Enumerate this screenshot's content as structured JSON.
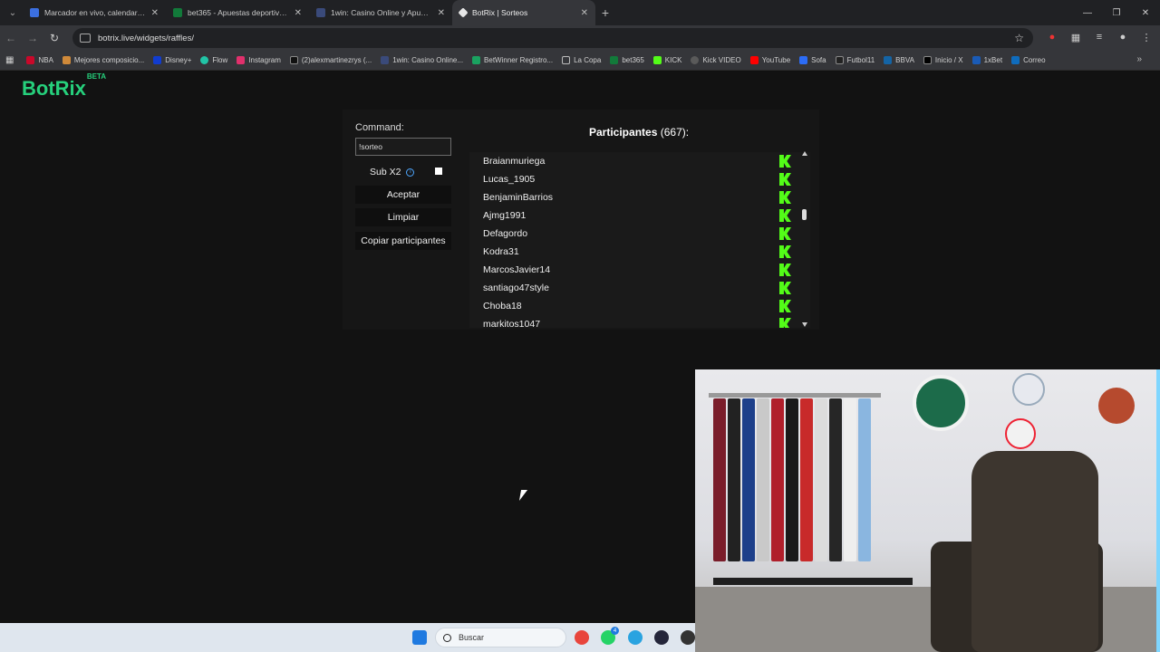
{
  "tabs": [
    {
      "title": "Marcador en vivo, calendario y",
      "color": "#3b6fe0",
      "active": false
    },
    {
      "title": "bet365 - Apuestas deportivas e",
      "color": "#127a3a",
      "active": false
    },
    {
      "title": "1win: Casino Online y Apuestas",
      "color": "#3a4a7a",
      "active": false
    },
    {
      "title": "BotRix | Sorteos",
      "color": "#e6e6e6",
      "active": true
    }
  ],
  "address": {
    "url": "botrix.live/widgets/raffles/"
  },
  "bookmarks": [
    {
      "label": "NBA",
      "color": "#c9082a"
    },
    {
      "label": "Mejores composicio...",
      "color": "#d08a3a"
    },
    {
      "label": "Disney+",
      "color": "#113ccf"
    },
    {
      "label": "Flow",
      "color": "#21c4a6"
    },
    {
      "label": "Instagram",
      "color": "#e1306c"
    },
    {
      "label": "(2)alexmartinezrys (...",
      "color": "#111111"
    },
    {
      "label": "1win: Casino Online...",
      "color": "#3a4a7a"
    },
    {
      "label": "BetWinner Registro...",
      "color": "#1aa260"
    },
    {
      "label": "La Copa",
      "color": "#8a8a8a"
    },
    {
      "label": "bet365",
      "color": "#127a3a"
    },
    {
      "label": "KICK",
      "color": "#53fc18"
    },
    {
      "label": "Kick VIDEO",
      "color": "#5a5a5a"
    },
    {
      "label": "YouTube",
      "color": "#ff0000"
    },
    {
      "label": "Sofa",
      "color": "#2c6cf6"
    },
    {
      "label": "Futbol11",
      "color": "#222222"
    },
    {
      "label": "BBVA",
      "color": "#1464a5"
    },
    {
      "label": "Inicio / X",
      "color": "#000000"
    },
    {
      "label": "1xBet",
      "color": "#1a5bb6"
    },
    {
      "label": "Correo",
      "color": "#0f6cbd"
    }
  ],
  "brand": {
    "name": "BotRix",
    "badge": "BETA",
    "color": "#26d07c"
  },
  "raffle": {
    "command_label": "Command:",
    "command_value": "!sorteo",
    "sub_label": "Sub X2",
    "info_glyph": "i",
    "buttons": {
      "accept": "Aceptar",
      "clear": "Limpiar",
      "copy": "Copiar participantes"
    },
    "participants_title": "Participantes",
    "participants_count": "(667):",
    "participants": [
      "Braianmuriega",
      "Lucas_1905",
      "BenjaminBarrios",
      "Ajmg1991",
      "Defagordo",
      "Kodra31",
      "MarcosJavier14",
      "santiago47style",
      "Choba18",
      "markitos1047"
    ],
    "platform_icon": "kick-icon",
    "platform_color": "#53fc18"
  },
  "taskbar": {
    "search_placeholder": "Buscar",
    "whatsapp_badge": "4"
  }
}
